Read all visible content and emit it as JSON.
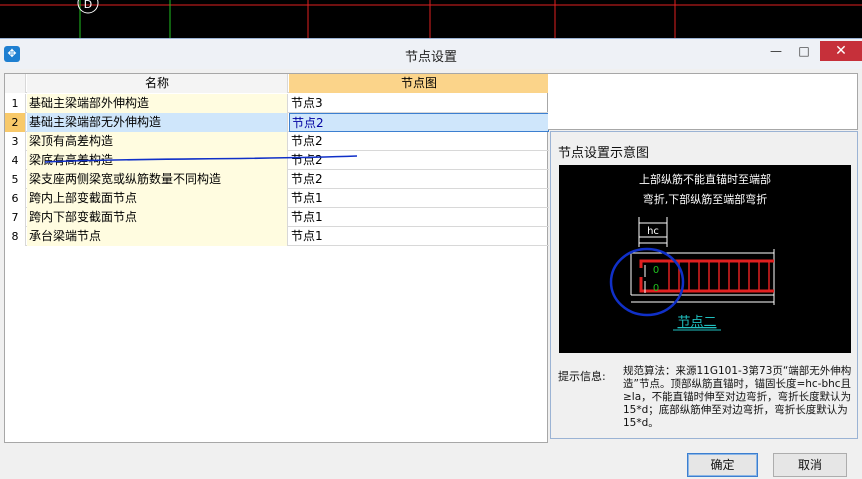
{
  "cad": {
    "node_label": "D"
  },
  "dialog": {
    "title": "节点设置",
    "window_min": "—",
    "window_max": "□",
    "window_close": "✕"
  },
  "grid": {
    "header": {
      "name": "名称",
      "node": "节点图"
    },
    "rows": [
      {
        "num": "1",
        "name": "基础主梁端部外伸构造",
        "node": "节点3"
      },
      {
        "num": "2",
        "name": "基础主梁端部无外伸构造",
        "node": "节点2"
      },
      {
        "num": "3",
        "name": "梁顶有高差构造",
        "node": "节点2"
      },
      {
        "num": "4",
        "name": "梁底有高差构造",
        "node": "节点2"
      },
      {
        "num": "5",
        "name": "梁支座两侧梁宽或纵筋数量不同构造",
        "node": "节点2"
      },
      {
        "num": "6",
        "name": "跨内上部变截面节点",
        "node": "节点1"
      },
      {
        "num": "7",
        "name": "跨内下部变截面节点",
        "node": "节点1"
      },
      {
        "num": "8",
        "name": "承台梁端节点",
        "node": "节点1"
      }
    ],
    "selected_row": 2
  },
  "preview": {
    "title": "节点设置示意图",
    "diagram": {
      "line1": "上部纵筋不能直锚时至端部",
      "line2": "弯折,下部纵筋至端部弯折",
      "hc": "hc",
      "zero_top": "0",
      "zero_bottom": "0",
      "caption": "节点二"
    },
    "hint_label": "提示信息:",
    "hint_text": "规范算法：来源11G101-3第73页“端部无外伸构造”节点。顶部纵筋直锚时，锚固长度=hc-bhc且≥la，不能直锚时伸至对边弯折，弯折长度默认为15*d；底部纵筋伸至对边弯折，弯折长度默认为15*d。"
  },
  "buttons": {
    "ok": "确定",
    "cancel": "取消"
  },
  "colors": {
    "accent": "#3c7fd0",
    "header_highlight": "#fbd48a",
    "cad_red": "#e02020",
    "cad_green": "#20c020"
  }
}
